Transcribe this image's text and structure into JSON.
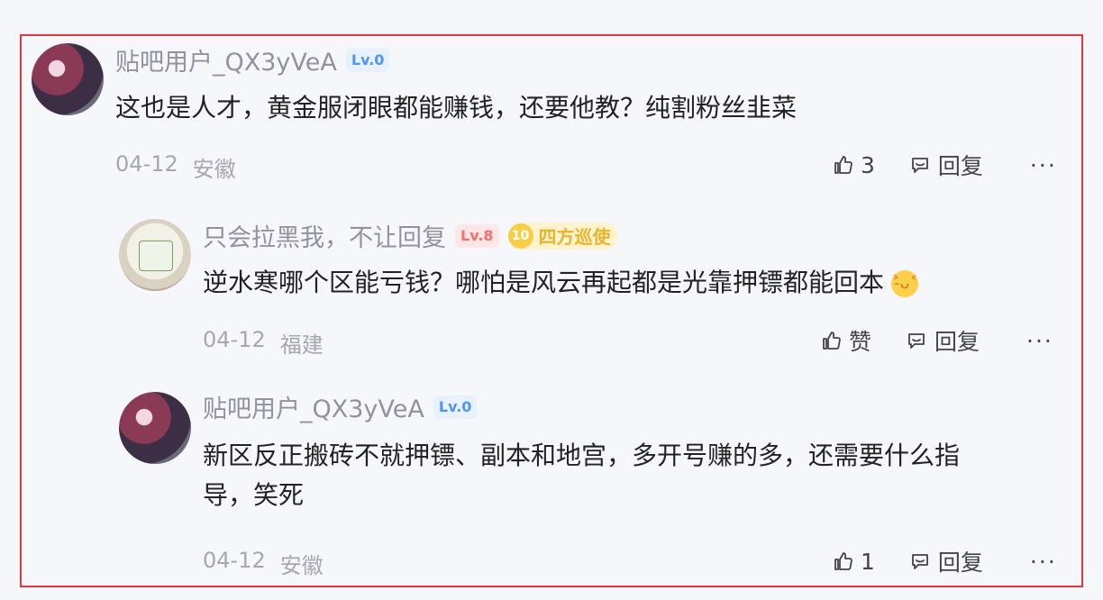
{
  "comments": [
    {
      "username": "贴吧用户_QX3yVeA",
      "level": "Lv.0",
      "content": "这也是人才，黄金服闭眼都能赚钱，还要他教？纯割粉丝韭菜",
      "date": "04-12",
      "location": "安徽",
      "like_count": "3",
      "reply_label": "回复",
      "more_label": "···"
    },
    {
      "username": "只会拉黑我，不让回复",
      "level": "Lv.8",
      "title_badge_number": "10",
      "title_badge_text": "四方巡使",
      "content": "逆水寒哪个区能亏钱？哪怕是风云再起都是光靠押镖都能回本",
      "emoji_name": "laughing-crying-emoji",
      "date": "04-12",
      "location": "福建",
      "like_label": "赞",
      "reply_label": "回复",
      "more_label": "···"
    },
    {
      "username": "贴吧用户_QX3yVeA",
      "level": "Lv.0",
      "content_line1": "新区反正搬砖不就押镖、副本和地宫，多开号赚的多，还需要什么指",
      "content_line2": "导，笑死",
      "date": "04-12",
      "location": "安徽",
      "like_count": "1",
      "reply_label": "回复",
      "more_label": "···"
    }
  ],
  "colors": {
    "frame_border": "#e23a3a",
    "username": "#8f93a1",
    "level_blue": "#4f95f1",
    "level_red": "#f0706d",
    "title_gold": "#e7b42b"
  }
}
